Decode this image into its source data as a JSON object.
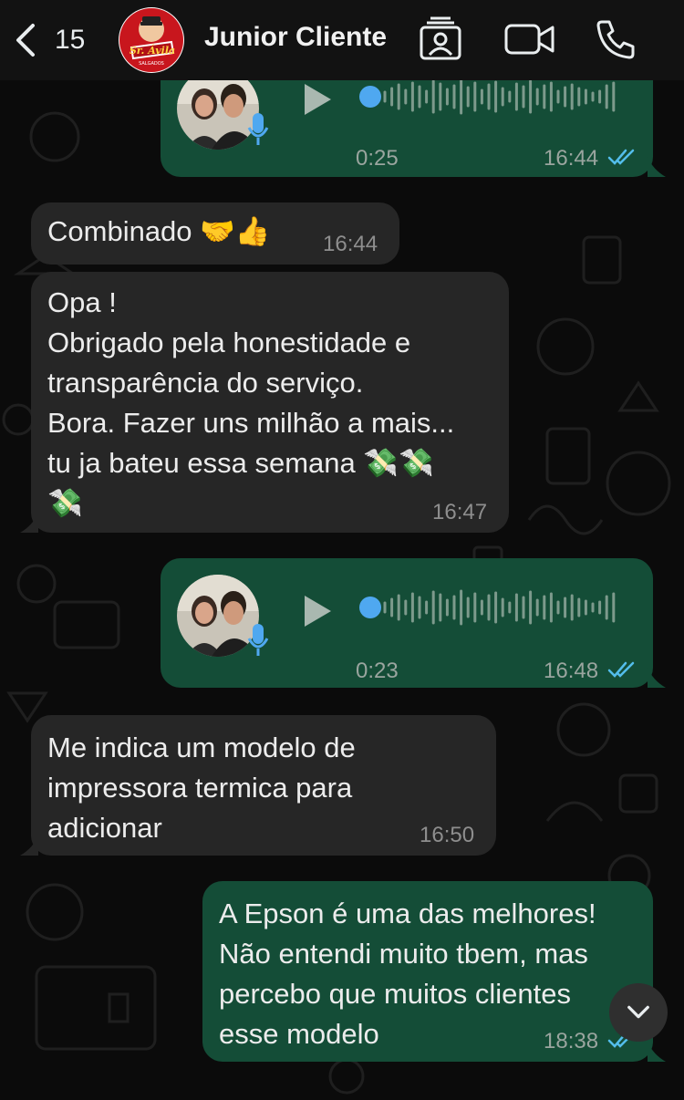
{
  "header": {
    "back_count": "15",
    "contact_name": "Junior Cliente",
    "avatar_brand": "Sr. Ávila",
    "avatar_sub": "SALGADOS"
  },
  "messages": [
    {
      "type": "voice",
      "direction": "out",
      "duration": "0:25",
      "time": "16:44",
      "status": "read"
    },
    {
      "type": "text",
      "direction": "in",
      "text": "Combinado 🤝👍",
      "time": "16:44"
    },
    {
      "type": "text",
      "direction": "in",
      "text": "Opa !\nObrigado pela honestidade e\ntransparência do serviço.\nBora. Fazer uns milhão a mais...\ntu ja bateu essa semana 💸💸\n💸",
      "time": "16:47"
    },
    {
      "type": "voice",
      "direction": "out",
      "duration": "0:23",
      "time": "16:48",
      "status": "read"
    },
    {
      "type": "text",
      "direction": "in",
      "text": "Me indica um modelo de\nimpressora termica para\nadicionar",
      "time": "16:50"
    },
    {
      "type": "text",
      "direction": "out",
      "text": "A Epson é uma das melhores!\nNão entendi muito tbem, mas\npercebo que muitos clientes\nesse modelo",
      "time": "18:38",
      "status": "read"
    }
  ],
  "colors": {
    "background": "#0b0b0b",
    "incoming_bubble": "#262626",
    "outgoing_bubble": "#144d37",
    "read_ticks": "#53bdeb",
    "voice_dot": "#4fa8f0"
  },
  "icons": {
    "back": "chevron-left-icon",
    "contact_card": "contact-card-icon",
    "video": "video-camera-icon",
    "phone": "phone-icon",
    "play": "play-icon",
    "mic": "microphone-icon",
    "scroll_down": "chevron-down-icon"
  }
}
